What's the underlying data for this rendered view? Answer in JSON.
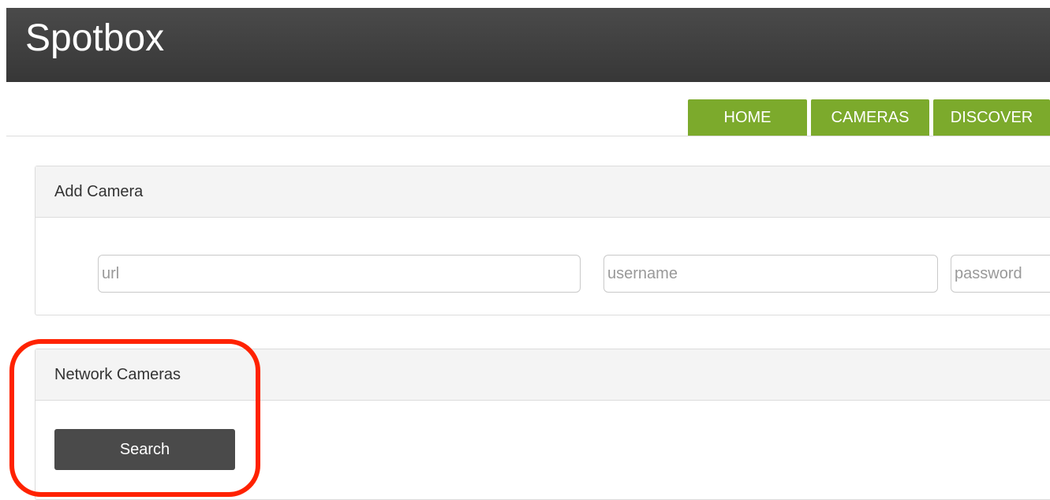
{
  "app": {
    "brand": "Spotbox"
  },
  "nav": {
    "tabs": [
      {
        "label": "HOME"
      },
      {
        "label": "CAMERAS"
      },
      {
        "label": "DISCOVER"
      }
    ],
    "accent_color": "#7caa2c"
  },
  "add_camera": {
    "title": "Add Camera",
    "url": {
      "value": "",
      "placeholder": "url"
    },
    "username": {
      "value": "",
      "placeholder": "username"
    },
    "password": {
      "value": "",
      "placeholder": "password"
    }
  },
  "network_cameras": {
    "title": "Network Cameras",
    "search_label": "Search"
  },
  "annotation": {
    "highlight_color": "#ff2200"
  }
}
